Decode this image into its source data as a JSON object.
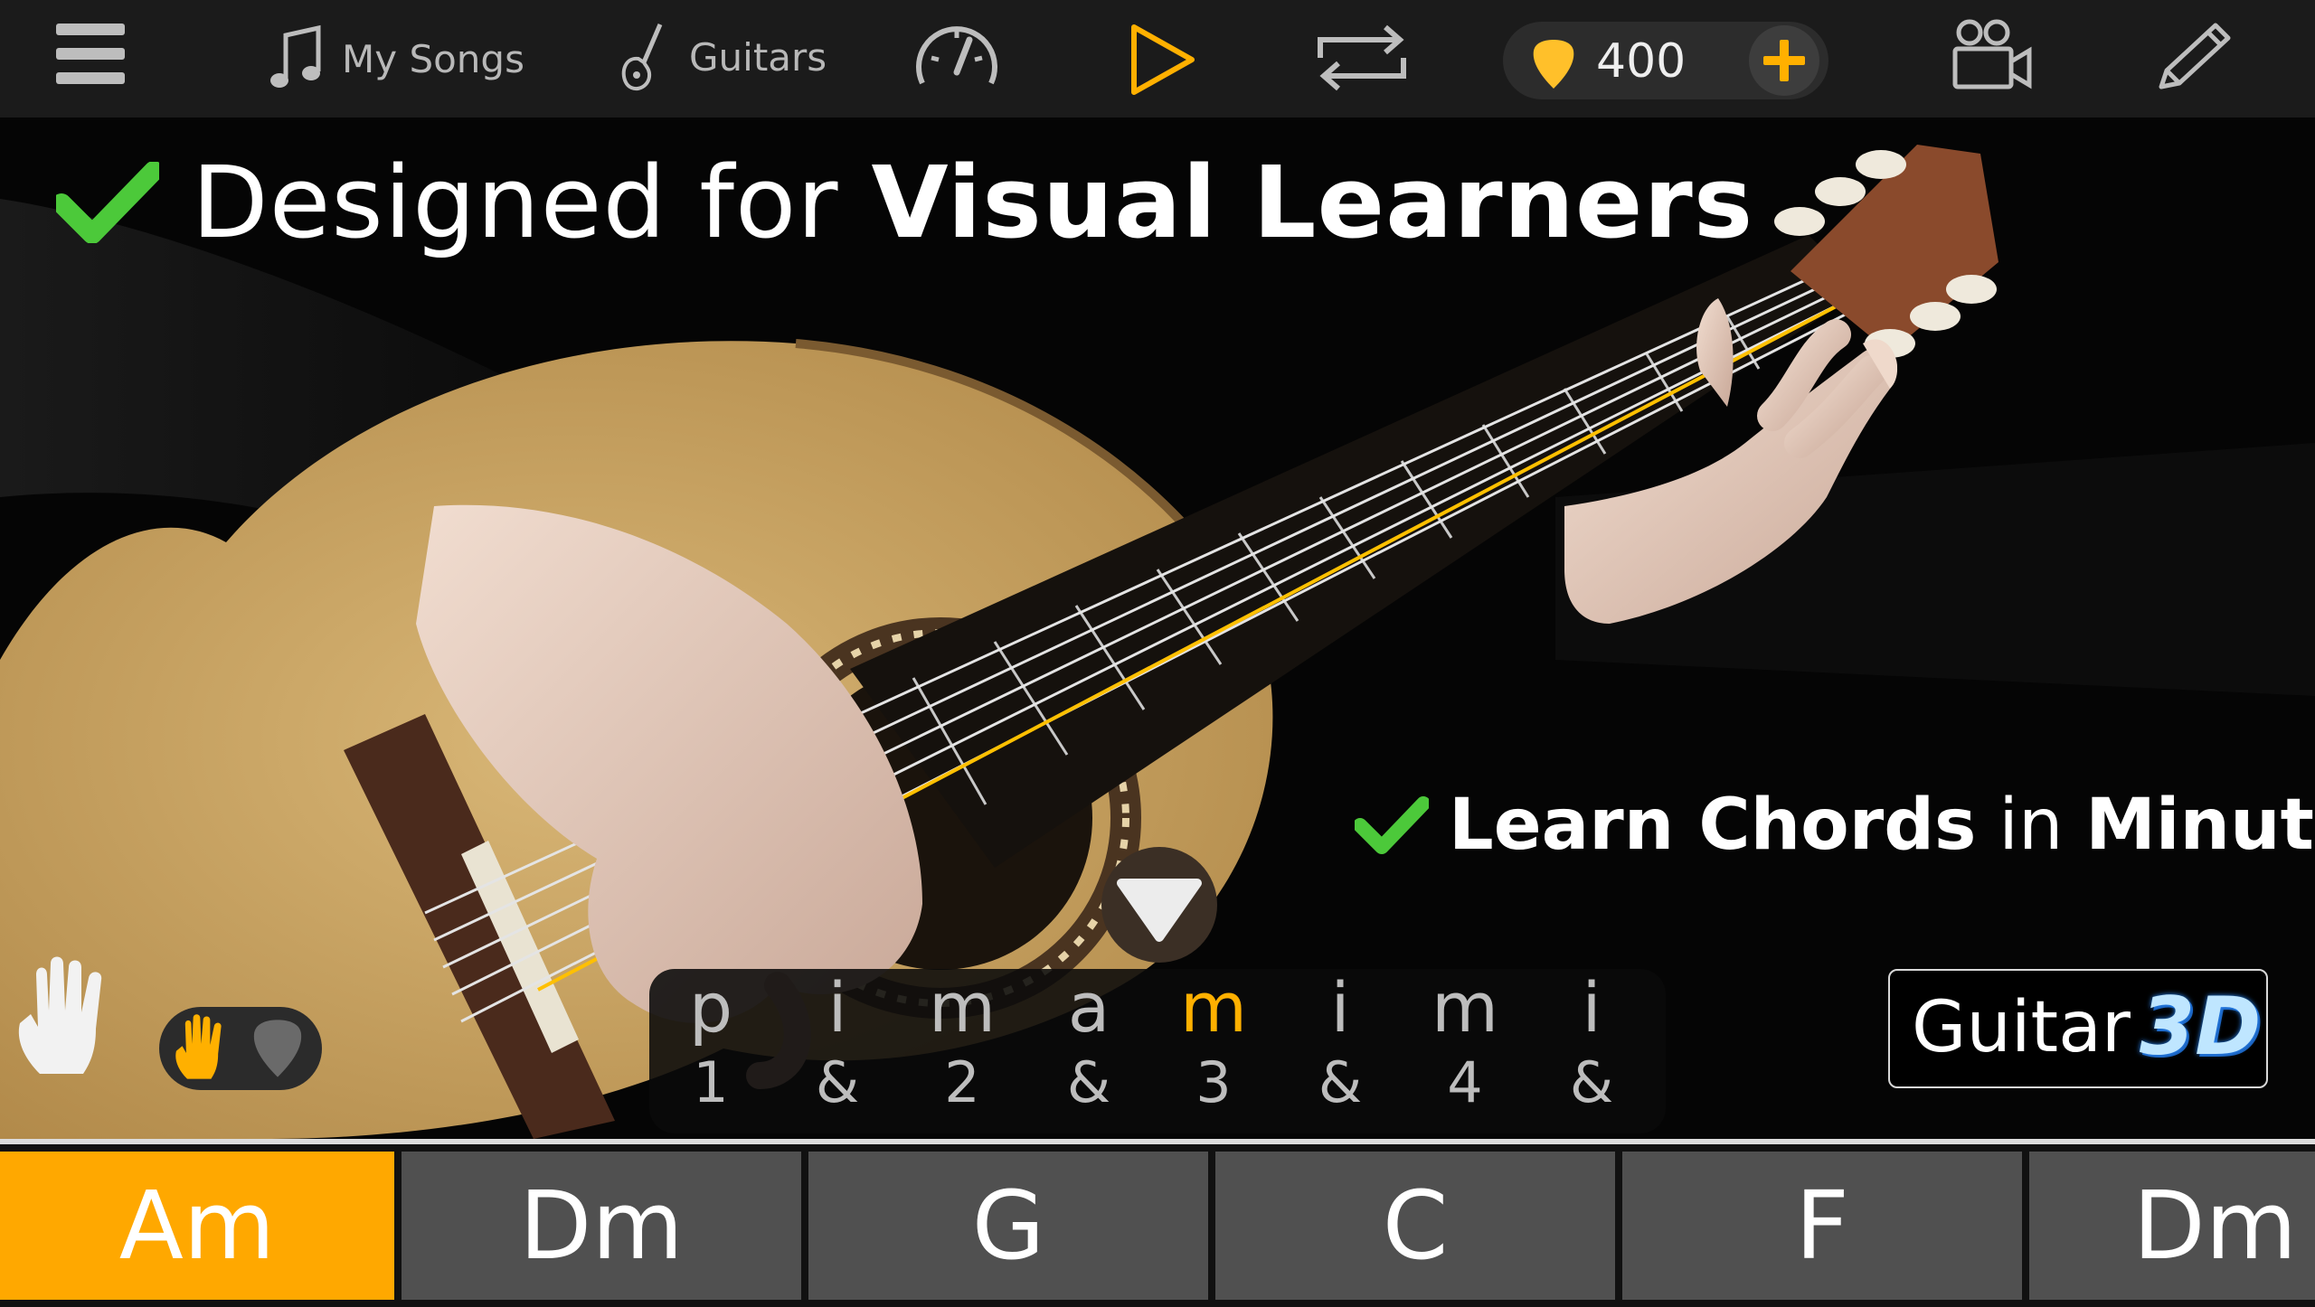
{
  "toolbar": {
    "menu_icon": "hamburger-icon",
    "my_songs_label": "My Songs",
    "guitars_label": "Guitars",
    "coins_value": "400"
  },
  "headline": {
    "prefix": "Designed for ",
    "emphasis": "Visual Learners"
  },
  "subline": {
    "part1": "Learn Chords",
    "part2": " in ",
    "part3": "Minutes"
  },
  "pattern": [
    {
      "finger": "p",
      "count": "1"
    },
    {
      "finger": "i",
      "count": "&"
    },
    {
      "finger": "m",
      "count": "2"
    },
    {
      "finger": "a",
      "count": "&"
    },
    {
      "finger": "m",
      "count": "3"
    },
    {
      "finger": "i",
      "count": "&"
    },
    {
      "finger": "m",
      "count": "4"
    },
    {
      "finger": "i",
      "count": "&"
    }
  ],
  "pattern_active_index": 4,
  "brand": {
    "word": "Guitar",
    "badge": "3D"
  },
  "chords": [
    "Am",
    "Dm",
    "G",
    "C",
    "F",
    "Dm"
  ],
  "selected_chord": 0,
  "colors": {
    "accent": "#ffa800",
    "check": "#4cc93a",
    "topbar": "#1b1b1b"
  }
}
